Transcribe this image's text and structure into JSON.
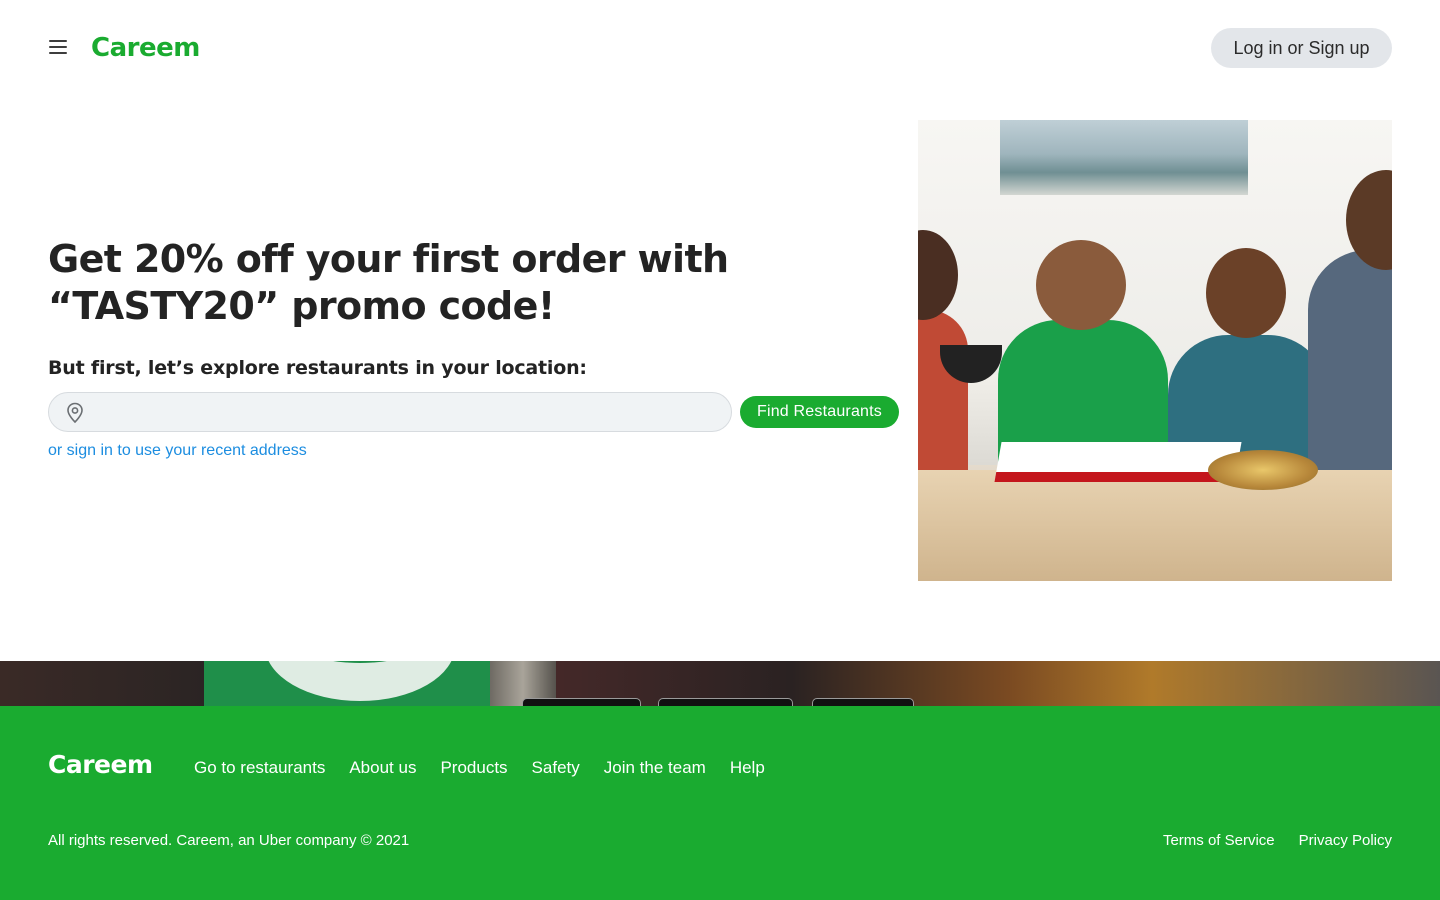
{
  "header": {
    "menu_icon": "hamburger-menu-icon",
    "logo_text": "Careem",
    "login_label": "Log in or Sign up"
  },
  "hero": {
    "title": "Get 20% off your first order with “TASTY20” promo code!",
    "subtitle": "But first, let’s explore restaurants in your location:",
    "location_input": {
      "value": "",
      "placeholder": "",
      "icon": "location-pin-icon"
    },
    "find_button_label": "Find Restaurants",
    "signin_link": "or sign in to use your recent address"
  },
  "footer": {
    "logo_text": "Careem",
    "nav": [
      "Go to restaurants",
      "About us",
      "Products",
      "Safety",
      "Join the team",
      "Help"
    ],
    "copyright": "All rights reserved. Careem, an Uber company © 2021",
    "legal": [
      "Terms of Service",
      "Privacy Policy"
    ]
  },
  "colors": {
    "brand_green": "#1aab30",
    "link_blue": "#1c8de0",
    "login_button_bg": "#e3e6ea",
    "input_bg": "#f0f3f5"
  }
}
